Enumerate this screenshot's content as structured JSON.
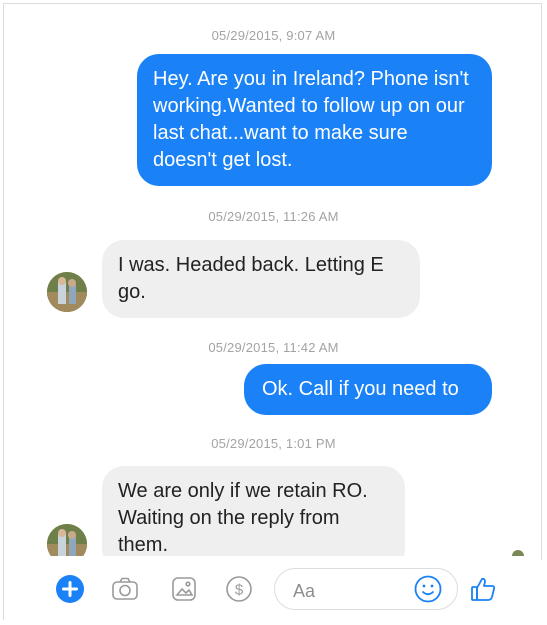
{
  "thread": {
    "messages": [
      {
        "timestamp": "05/29/2015, 9:07 AM",
        "direction": "outgoing",
        "text": "Hey. Are you in Ireland? Phone isn't working.Wanted to follow up on our last chat...want to make sure doesn't get lost."
      },
      {
        "timestamp": "05/29/2015, 11:26 AM",
        "direction": "incoming",
        "text": "I was. Headed back. Letting E go."
      },
      {
        "timestamp": "05/29/2015, 11:42 AM",
        "direction": "outgoing",
        "text": "Ok. Call if you need to"
      },
      {
        "timestamp": "05/29/2015, 1:01 PM",
        "direction": "incoming",
        "text": "We are only if we retain RO. Waiting on the reply from them."
      }
    ]
  },
  "composer": {
    "placeholder": "Aa",
    "icons": [
      "plus-icon",
      "camera-icon",
      "gallery-icon",
      "payment-icon",
      "emoji-icon",
      "thumbs-up-icon"
    ]
  },
  "colors": {
    "outgoing_bubble": "#1a82f6",
    "incoming_bubble": "#efefef",
    "accent": "#1a82f6",
    "timestamp": "#a3a3a3"
  }
}
